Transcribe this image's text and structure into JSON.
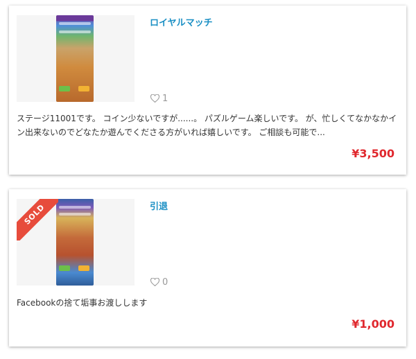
{
  "listings": [
    {
      "title": "ロイヤルマッチ",
      "likes": "1",
      "description": "ステージ11001です。 コイン少ないですが......。 パズルゲーム楽しいです。 が、忙しくてなかなかイン出来ないのでどなたか遊んでくださる方がいれば嬉しいです。 ご相談も可能で...",
      "price": "¥3,500",
      "sold": false
    },
    {
      "title": "引退",
      "likes": "0",
      "description": "Facebookの捨て垢事お渡しします",
      "price": "¥1,000",
      "sold": true,
      "sold_label": "SOLD"
    }
  ],
  "colors": {
    "title": "#1a8fc4",
    "price": "#e0282e",
    "sold_ribbon": "#e74c3c",
    "like_icon": "#999999"
  },
  "icons": {
    "like": "heart-outline-icon"
  }
}
